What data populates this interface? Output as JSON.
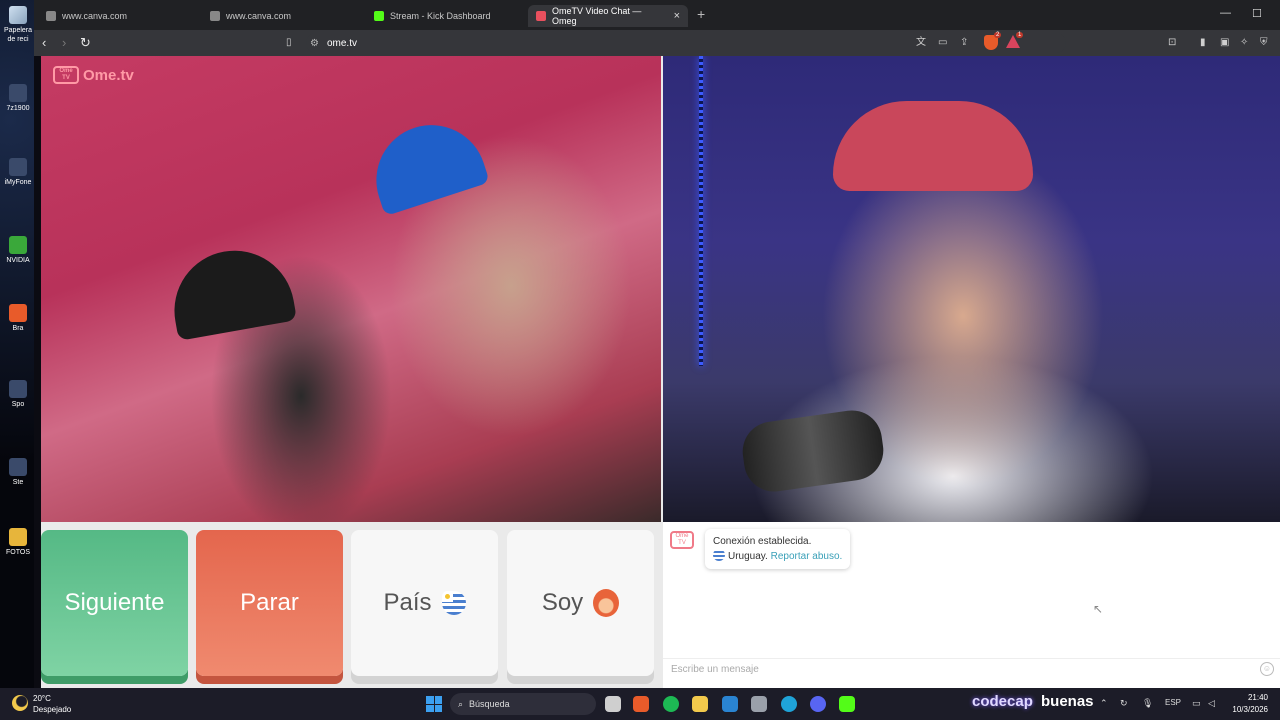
{
  "desktop": {
    "items": [
      "Papelera de reci",
      "7z1900",
      "iMyFone",
      "NVIDIA",
      "Bra",
      "Spo",
      "Ste",
      "FOTOS"
    ]
  },
  "browser": {
    "tabs": [
      {
        "title": "www.canva.com",
        "icon": "canva-icon"
      },
      {
        "title": "www.canva.com",
        "icon": "canva-icon"
      },
      {
        "title": "Stream - Kick Dashboard",
        "icon": "kick-icon"
      },
      {
        "title": "OmeTV Video Chat — Omeg",
        "icon": "ometv-icon",
        "active": true
      }
    ],
    "new_tab_label": "+",
    "url": "ome.tv",
    "badges": {
      "brave_shield_count": "2",
      "rewards_count": "1"
    }
  },
  "page": {
    "logo_text": "Ome.tv",
    "logo_box_text": "Ome TV",
    "buttons": {
      "next": "Siguiente",
      "stop": "Parar",
      "country": "País",
      "gender": "Soy"
    },
    "chat": {
      "system_logo_text": "Ome TV",
      "status_message": "Conexión establecida.",
      "country": "Uruguay.",
      "report_link": "Reportar abuso.",
      "input_placeholder": "Escribe un mensaje"
    }
  },
  "taskbar": {
    "weather_temp": "20°C",
    "weather_desc": "Despejado",
    "search_placeholder": "Búsqueda",
    "overlay_left": "codecap",
    "overlay_right": "buenas",
    "language": "ESP",
    "time": "21:40",
    "date": "10/3/2026"
  },
  "colors": {
    "next_button": "#55b985",
    "stop_button": "#e4664d",
    "link": "#3aa0b8",
    "logo": "#ff9aa6"
  }
}
